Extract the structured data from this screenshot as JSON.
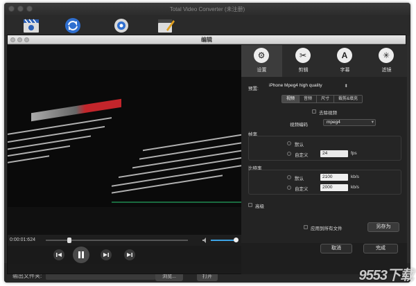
{
  "app": {
    "title": "Total Video Converter (未注册)",
    "toolbar": [
      {
        "name": "add-video-icon"
      },
      {
        "name": "convert-icon"
      },
      {
        "name": "settings-icon"
      },
      {
        "name": "edit-icon"
      }
    ]
  },
  "dialog": {
    "title": "编辑",
    "tabs": [
      {
        "label": "设置",
        "icon": "gear-icon"
      },
      {
        "label": "剪辑",
        "icon": "scissors-icon"
      },
      {
        "label": "字幕",
        "icon": "text-icon"
      },
      {
        "label": "滤镜",
        "icon": "sparkle-icon"
      }
    ],
    "preset_label": "预置:",
    "preset_value": "iPhone Mpeg4 high quality",
    "segments": [
      "视频",
      "音频",
      "尺寸",
      "裁剪&填充"
    ],
    "remove_video_label": "去除视频",
    "video_codec_label": "视频编码",
    "video_codec_value": "mpeg4",
    "framerate": {
      "title": "帧率",
      "default_label": "默认",
      "custom_label": "自定义",
      "custom_value": "24",
      "unit": "fps"
    },
    "bitrate": {
      "title": "比特率",
      "default_label": "默认",
      "default_value": "2100",
      "custom_label": "自定义",
      "custom_value": "2000",
      "unit": "kb/s"
    },
    "advanced_label": "高级",
    "apply_all_label": "应用到所有文件",
    "save_as_label": "另存为",
    "cancel_label": "取消",
    "done_label": "完成"
  },
  "player": {
    "time": "0:00:01:624",
    "progress": 0.15,
    "volume": 0.95
  },
  "bottom": {
    "output_label": "输出文件夹:",
    "browse_label": "浏览...",
    "open_label": "打开"
  },
  "watermark": "9553下载"
}
